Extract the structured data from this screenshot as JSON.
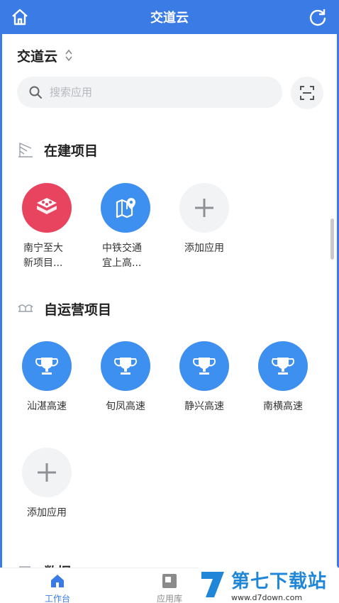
{
  "header": {
    "title": "交道云"
  },
  "org": {
    "name": "交道云"
  },
  "search": {
    "placeholder": "搜索应用"
  },
  "sections": [
    {
      "title": "在建项目",
      "apps": [
        {
          "line1": "南宁至大",
          "line2": "新项目...",
          "icon": "cubes-icon",
          "color": "#e8435f"
        },
        {
          "line1": "中铁交通",
          "line2": "宜上高...",
          "icon": "map-pin-icon",
          "color": "#3d8ff0"
        },
        {
          "label": "添加应用",
          "icon": "plus-icon",
          "color": "#f2f3f5"
        }
      ]
    },
    {
      "title": "自运营项目",
      "apps": [
        {
          "label": "汕湛高速",
          "icon": "trophy-icon",
          "color": "#3d8ff0"
        },
        {
          "label": "旬凤高速",
          "icon": "trophy-icon",
          "color": "#3d8ff0"
        },
        {
          "label": "静兴高速",
          "icon": "trophy-icon",
          "color": "#3d8ff0"
        },
        {
          "label": "南横高速",
          "icon": "trophy-icon",
          "color": "#3d8ff0"
        },
        {
          "label": "添加应用",
          "icon": "plus-icon",
          "color": "#f2f3f5"
        }
      ]
    }
  ],
  "next_section": {
    "title": "数据"
  },
  "tabs": [
    {
      "label": "工作台",
      "color": "#3a7be6"
    },
    {
      "label": "应用库",
      "color": "#8a8a8a"
    }
  ],
  "watermark": {
    "name": "第七下载站",
    "url": "www.d7down.com"
  }
}
